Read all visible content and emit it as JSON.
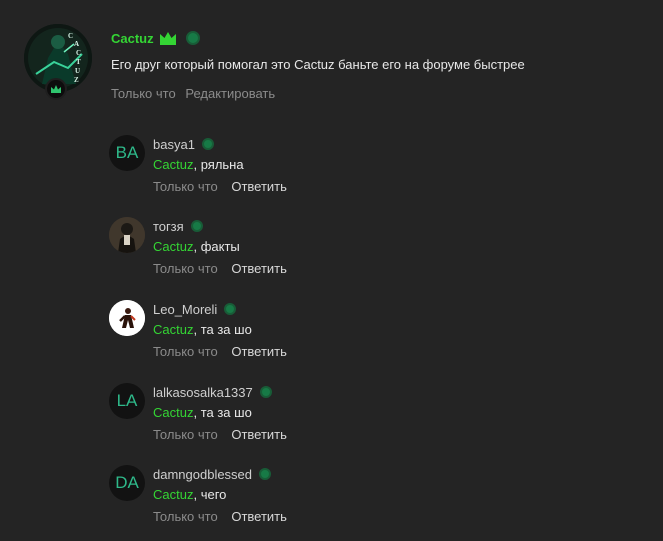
{
  "main_comment": {
    "author": "Cactuz",
    "text": "Его друг который помогал это Cactuz баньте его на форуме быстрее",
    "time": "Только что",
    "edit_label": "Редактировать",
    "colors": {
      "admin_name": "#34d534",
      "online": "#177a46",
      "background": "#242424"
    }
  },
  "replies": [
    {
      "author": "basya1",
      "avatar_initials": "BA",
      "mention": "Cactuz",
      "text": ", ряльна",
      "time": "Только что",
      "reply_label": "Ответить"
    },
    {
      "author": "тогзя",
      "avatar_initials": "",
      "mention": "Cactuz",
      "text": ", факты",
      "time": "Только что",
      "reply_label": "Ответить"
    },
    {
      "author": "Leo_Moreli",
      "avatar_initials": "",
      "mention": "Cactuz",
      "text": ", та за шо",
      "time": "Только что",
      "reply_label": "Ответить"
    },
    {
      "author": "lalkasosalka1337",
      "avatar_initials": "LA",
      "mention": "Cactuz",
      "text": ", та за шо",
      "time": "Только что",
      "reply_label": "Ответить"
    },
    {
      "author": "damngodblessed",
      "avatar_initials": "DA",
      "mention": "Cactuz",
      "text": ", чего",
      "time": "Только что",
      "reply_label": "Ответить"
    }
  ]
}
